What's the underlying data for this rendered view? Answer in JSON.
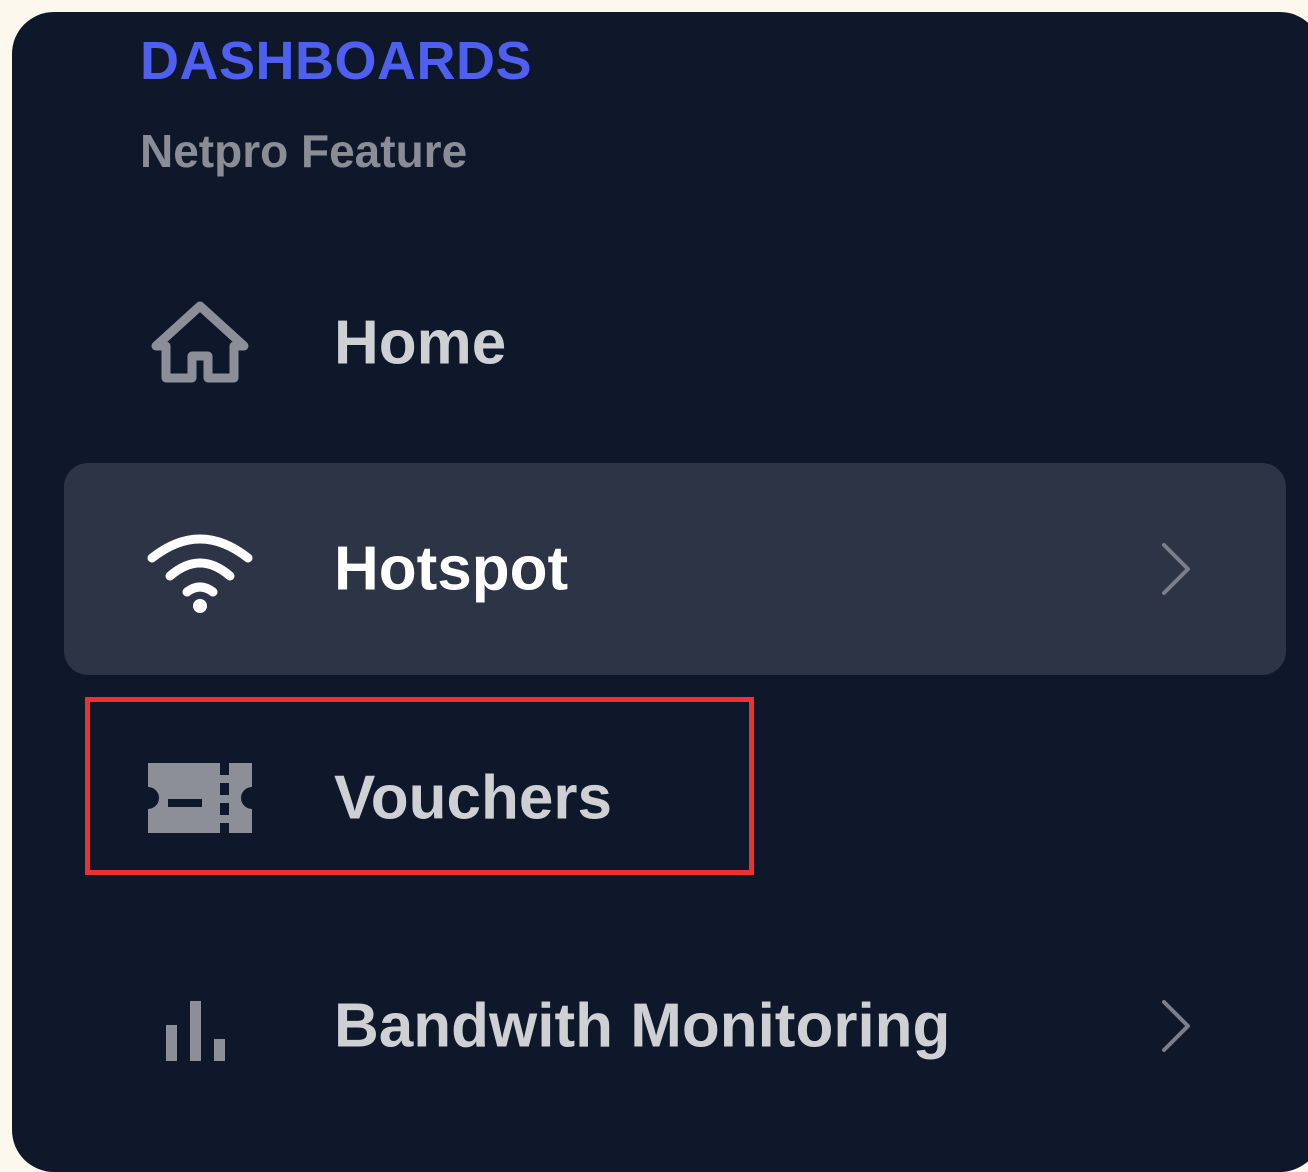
{
  "sidebar": {
    "section_title": "DASHBOARDS",
    "section_subtitle": "Netpro Feature",
    "items": [
      {
        "label": "Home",
        "icon": "home-icon",
        "active": false,
        "has_submenu": false
      },
      {
        "label": "Hotspot",
        "icon": "wifi-icon",
        "active": true,
        "has_submenu": true
      },
      {
        "label": "Vouchers",
        "icon": "ticket-icon",
        "active": false,
        "has_submenu": false,
        "highlighted": true
      },
      {
        "label": "Bandwith Monitoring",
        "icon": "bar-chart-icon",
        "active": false,
        "has_submenu": true
      }
    ]
  },
  "colors": {
    "page_background": "#fdf8ee",
    "sidebar_background": "#0f172a",
    "active_item_background": "#2d3446",
    "section_title": "#4f5ff0",
    "section_subtitle": "#8a8d96",
    "label": "#cfd0d4",
    "active_label": "#ffffff",
    "icon": "#8c8f98",
    "active_icon": "#ffffff",
    "highlight_border": "#ef3030"
  }
}
